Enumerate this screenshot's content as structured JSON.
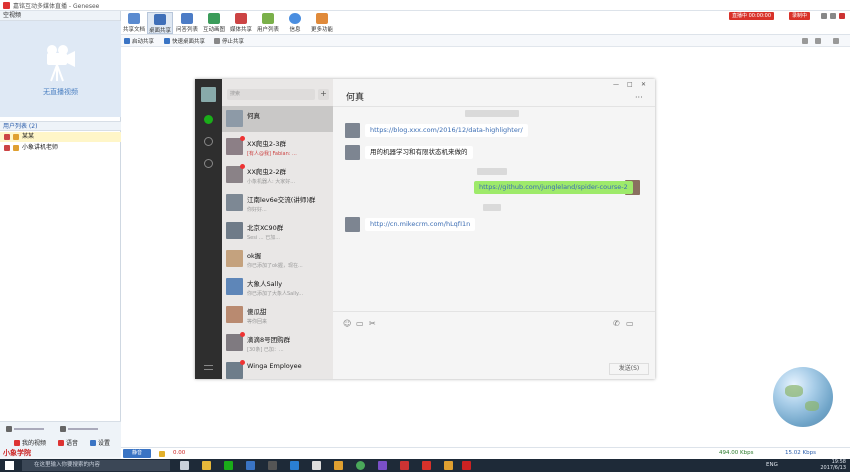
{
  "window": {
    "title": "嘉铭互动多媒体直播 - Genesee"
  },
  "left_panel": {
    "header": "空视频",
    "no_video_label": "无直播视频",
    "users_header": "用户列表 (2)",
    "users": [
      {
        "name": "某某",
        "selected": true
      },
      {
        "name": "小象讲机老师",
        "selected": false
      }
    ],
    "bottom": {
      "my_device": "我的视频",
      "voice": "语音",
      "settings": "设置",
      "brand": "小象学院"
    }
  },
  "toolbar": {
    "buttons": [
      {
        "label": "共享文档",
        "icon": "document-icon",
        "active": false
      },
      {
        "label": "桌面共享",
        "icon": "desktop-share-icon",
        "active": true
      },
      {
        "label": "问答列表",
        "icon": "qa-list-icon",
        "active": false
      },
      {
        "label": "互动画图",
        "icon": "whiteboard-icon",
        "active": false
      },
      {
        "label": "媒体共享",
        "icon": "media-share-icon",
        "active": false
      },
      {
        "label": "用户列表",
        "icon": "users-icon",
        "active": false
      },
      {
        "label": "信息",
        "icon": "info-icon",
        "active": false
      },
      {
        "label": "更多功能",
        "icon": "more-icon",
        "active": false
      }
    ],
    "live_status": "直播中 00:00:00",
    "record_label": "录制中"
  },
  "subbar": {
    "start_share": "启动共享",
    "quick_share": "快速桌面共享",
    "stop_share": "停止共享"
  },
  "wechat": {
    "search_placeholder": "搜索",
    "chats": [
      {
        "name": "何真",
        "msg": "",
        "time": "",
        "active": true,
        "unread": false
      },
      {
        "name": "XX爬虫2-3群",
        "msg": "[有人@我] Fabian: ...",
        "time": "",
        "active": false,
        "unread": true
      },
      {
        "name": "XX爬虫2-2群",
        "msg": "小象机器人: 大家好...",
        "time": "",
        "active": false,
        "unread": true
      },
      {
        "name": "江南lev6e交流(讲师)群",
        "msg": "你好好...",
        "time": "",
        "active": false,
        "unread": false
      },
      {
        "name": "北京XC90群",
        "msg": "Sesi ... 已加...",
        "time": "",
        "active": false,
        "unread": false
      },
      {
        "name": "ok握",
        "msg": "你已添加了ok握，现在...",
        "time": "",
        "active": false,
        "unread": false
      },
      {
        "name": "大象人Sally",
        "msg": "你已添加了大象人Sally...",
        "time": "",
        "active": false,
        "unread": false
      },
      {
        "name": "傻瓜甜",
        "msg": "等你回来",
        "time": "",
        "active": false,
        "unread": false
      },
      {
        "name": "滴滴8号团购群",
        "msg": "[30条] 已加：...",
        "time": "",
        "active": false,
        "unread": true
      },
      {
        "name": "Winga Employee",
        "msg": "",
        "time": "",
        "active": false,
        "unread": true
      }
    ],
    "conversation": {
      "title": "何真",
      "messages": [
        {
          "text": "https://blog.xxx.com/2016/12/data-highlighter/",
          "mine": false,
          "link": true
        },
        {
          "text": "用的机器学习和有限状态机来做的",
          "mine": false,
          "link": false
        },
        {
          "text": "https://github.com/jungleland/spider-course-2",
          "mine": true,
          "link": true
        },
        {
          "text": "http://cn.mikecrm.com/hLqfI1n",
          "mine": false,
          "link": true
        }
      ],
      "send_label": "发送(S)"
    }
  },
  "statusbar": {
    "mic_label": "静音",
    "error_count": "0.00",
    "down_speed": "494.00 Kbps",
    "up_speed": "15.02 Kbps"
  },
  "taskbar": {
    "search_placeholder": "在这里输入你要搜索的内容",
    "lang": "ENG",
    "time": "19:58",
    "date": "2017/6/13"
  }
}
